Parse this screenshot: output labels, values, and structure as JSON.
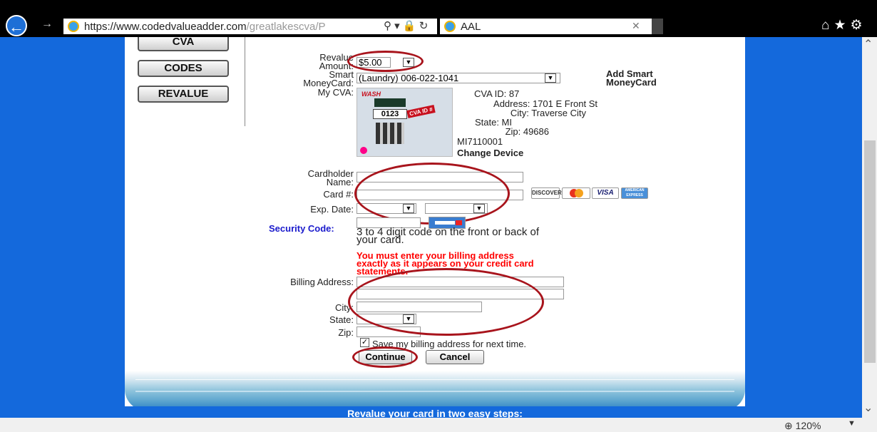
{
  "browser": {
    "url_main": "https://www.codedvalueadder.com",
    "url_rest": "/greatlakescva/P",
    "tab_title": "AAL",
    "back_icon": "back-arrow-icon",
    "zoom": "120%"
  },
  "nav": {
    "cva": "CVA",
    "codes": "CODES",
    "revalue": "REVALUE"
  },
  "form": {
    "revalue_label_1": "Revalue",
    "revalue_label_2": "Amount:",
    "revalue_value": "$5.00",
    "smart_label_1": "Smart",
    "smart_label_2": "MoneyCard:",
    "smart_value": "(Laundry) 006-022-1041",
    "add_smart_1": "Add Smart",
    "add_smart_2": "MoneyCard",
    "mycva_label": "My CVA:",
    "cva_id": "CVA ID: 87",
    "address": "Address: 1701 E Front St",
    "city": "City: Traverse City",
    "state": "State: MI",
    "zip": "Zip: 49686",
    "device_code": "MI7110001",
    "change_device": "Change Device",
    "kiosk_brand": "WASH",
    "kiosk_number": "0123",
    "kiosk_badge": "CVA ID #",
    "cardholder_1": "Cardholder",
    "cardholder_2": "Name:",
    "card_num_label": "Card #:",
    "exp_label": "Exp. Date:",
    "security_label": "Security Code:",
    "security_help_1": "3 to 4 digit code on the front or back of",
    "security_help_2": "your card.",
    "warning_1": "You must enter your billing address",
    "warning_2": "exactly as it appears on your credit card",
    "warning_3": "statements.",
    "billing_label": "Billing Address:",
    "city_label": "City:",
    "state_label": "State:",
    "zip_label": "Zip:",
    "save_label": "Save my billing address for next time.",
    "continue": "Continue",
    "cancel": "Cancel"
  },
  "card_logos": {
    "discover": "DISCOVER",
    "visa": "VISA",
    "amex": "AMERICAN EXPRESS"
  },
  "footer": "Revalue your card in two easy steps:",
  "colors": {
    "page_blue": "#1469dc",
    "annotation_red": "#a8141c",
    "warning_red": "#ff0000",
    "security_blue": "#1a1acc"
  }
}
